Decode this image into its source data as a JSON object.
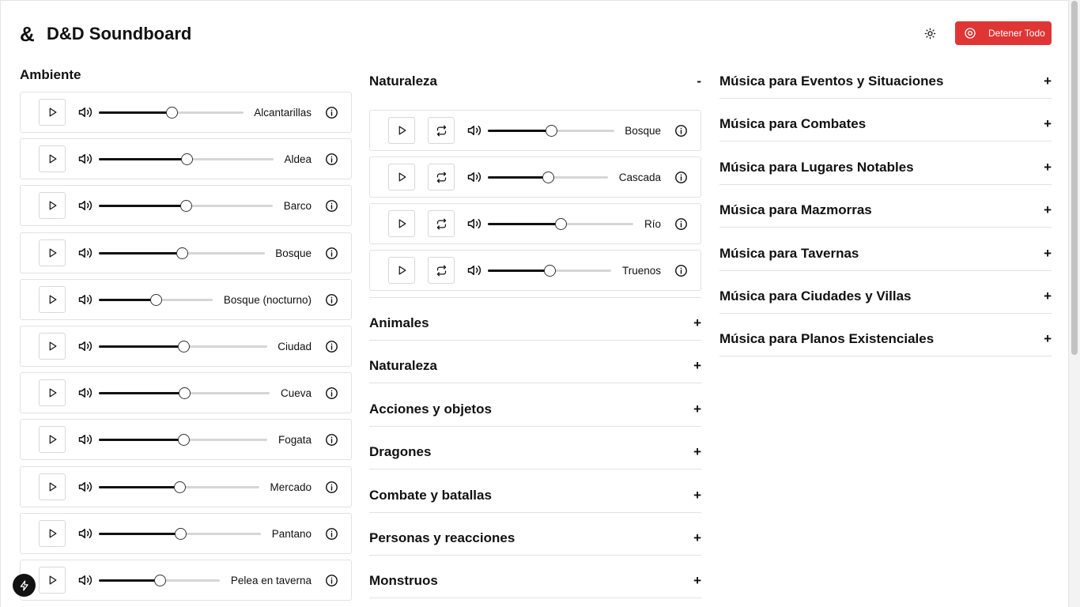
{
  "header": {
    "logo_glyph": "&",
    "title": "D&D Soundboard",
    "stop_all_label": "Detener Todo",
    "stop_button_color": "#e03535"
  },
  "ambiente": {
    "title": "Ambiente",
    "sounds": [
      {
        "label": "Alcantarillas",
        "volume": 0.5
      },
      {
        "label": "Aldea",
        "volume": 0.5
      },
      {
        "label": "Barco",
        "volume": 0.5
      },
      {
        "label": "Bosque",
        "volume": 0.5
      },
      {
        "label": "Bosque (nocturno)",
        "volume": 0.5
      },
      {
        "label": "Ciudad",
        "volume": 0.5
      },
      {
        "label": "Cueva",
        "volume": 0.5
      },
      {
        "label": "Fogata",
        "volume": 0.5
      },
      {
        "label": "Mercado",
        "volume": 0.5
      },
      {
        "label": "Pantano",
        "volume": 0.5
      },
      {
        "label": "Pelea en taverna",
        "volume": 0.5
      }
    ]
  },
  "efectos": {
    "open_group": {
      "title": "Naturaleza",
      "sign": "-",
      "sounds": [
        {
          "label": "Bosque",
          "volume": 0.5
        },
        {
          "label": "Cascada",
          "volume": 0.5
        },
        {
          "label": "Río",
          "volume": 0.5
        },
        {
          "label": "Truenos",
          "volume": 0.5
        }
      ]
    },
    "groups": [
      {
        "title": "Animales",
        "sign": "+"
      },
      {
        "title": "Naturaleza",
        "sign": "+"
      },
      {
        "title": "Acciones y objetos",
        "sign": "+"
      },
      {
        "title": "Dragones",
        "sign": "+"
      },
      {
        "title": "Combate y batallas",
        "sign": "+"
      },
      {
        "title": "Personas y reacciones",
        "sign": "+"
      },
      {
        "title": "Monstruos",
        "sign": "+"
      }
    ]
  },
  "musica": {
    "groups": [
      {
        "title": "Música para Eventos y Situaciones",
        "sign": "+"
      },
      {
        "title": "Música para Combates",
        "sign": "+"
      },
      {
        "title": "Música para Lugares Notables",
        "sign": "+"
      },
      {
        "title": "Música para Mazmorras",
        "sign": "+"
      },
      {
        "title": "Música para Tavernas",
        "sign": "+"
      },
      {
        "title": "Música para Ciudades y Villas",
        "sign": "+"
      },
      {
        "title": "Música para Planos Existenciales",
        "sign": "+"
      }
    ]
  },
  "icons": {
    "play": "play-icon",
    "loop": "repeat-icon",
    "volume": "volume-icon",
    "info": "info-icon",
    "theme": "sun-icon",
    "stop": "stop-circle-icon",
    "fab": "lightning-icon"
  }
}
